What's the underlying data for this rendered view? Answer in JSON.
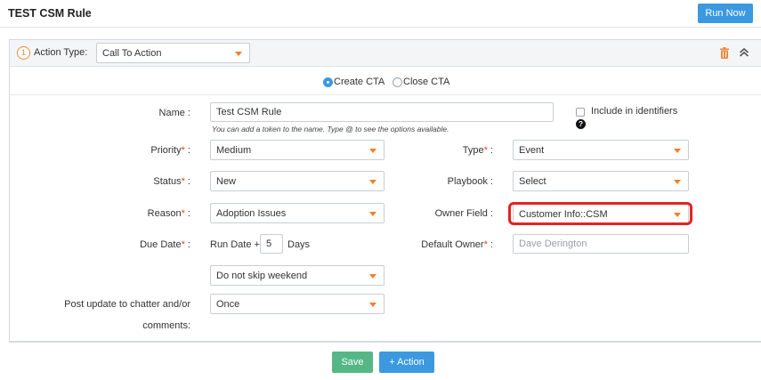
{
  "header": {
    "title": "TEST CSM Rule",
    "run_now_label": "Run Now"
  },
  "action": {
    "step_number": "1",
    "type_label": "Action Type:",
    "type_value": "Call To Action",
    "cta_options": [
      {
        "label": "Create CTA",
        "selected": true
      },
      {
        "label": "Close CTA",
        "selected": false
      }
    ]
  },
  "form": {
    "name": {
      "label": "Name :",
      "value": "Test CSM Rule",
      "hint": "You can add a token to the name. Type @ to see the options available."
    },
    "include_identifiers": {
      "label": "Include in identifiers",
      "checked": false
    },
    "priority": {
      "label": "Priority",
      "required_mark": "*",
      "suffix": " :",
      "value": "Medium"
    },
    "type": {
      "label": "Type",
      "required_mark": "*",
      "suffix": " :",
      "value": "Event"
    },
    "status": {
      "label": "Status",
      "required_mark": "*",
      "suffix": " :",
      "value": "New"
    },
    "playbook": {
      "label": "Playbook :",
      "value": "Select"
    },
    "reason": {
      "label": "Reason",
      "required_mark": "*",
      "suffix": " :",
      "value": "Adoption Issues"
    },
    "owner_field": {
      "label": "Owner Field :",
      "value": "Customer Info::CSM"
    },
    "due_date": {
      "label": "Due Date",
      "required_mark": "*",
      "suffix": " :",
      "prefix_text": "Run Date +",
      "days_value": "5",
      "days_label": "Days"
    },
    "default_owner": {
      "label": "Default Owner",
      "required_mark": "*",
      "suffix": " :",
      "placeholder": "Dave Derington"
    },
    "weekend": {
      "value": "Do not skip weekend"
    },
    "post_update": {
      "label_line1": "Post update to chatter and/or",
      "label_line2": "comments:",
      "value": "Once"
    }
  },
  "footer": {
    "save_label": "Save",
    "add_action_label": "+ Action"
  },
  "colors": {
    "accent_blue": "#3b99e0",
    "save_green": "#55b786",
    "caret_orange": "#f07f2a",
    "highlight_red": "#e02424",
    "required_red": "#e8412f"
  },
  "icons": {
    "trash": "trash-icon",
    "collapse": "chevron-double-up-icon",
    "help": "question-circle-icon",
    "dropdown": "caret-down-icon"
  }
}
